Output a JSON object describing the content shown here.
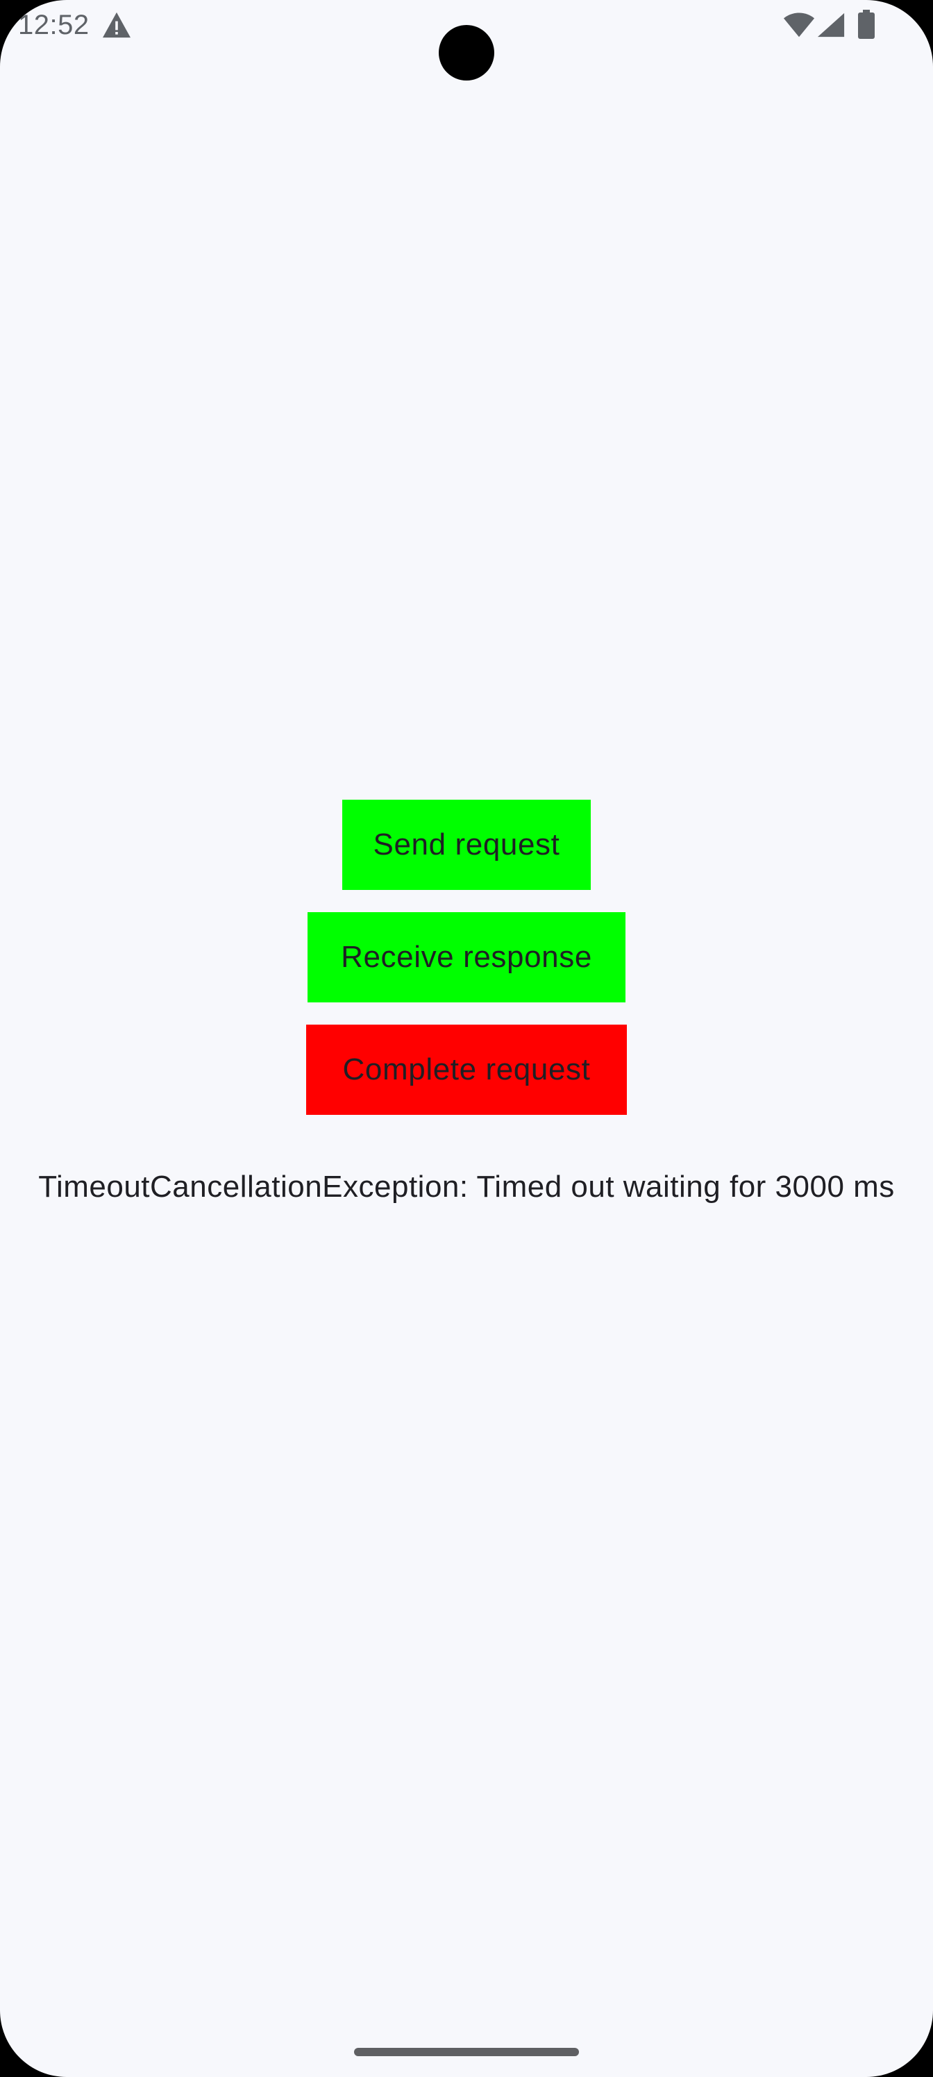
{
  "status_bar": {
    "time": "12:52",
    "icons": [
      "warning-icon",
      "wifi-icon",
      "signal-icon",
      "battery-icon"
    ],
    "icon_color": "#5f6368"
  },
  "buttons": {
    "send_request": {
      "label": "Send request",
      "color": "#00ff00"
    },
    "receive_response": {
      "label": "Receive response",
      "color": "#00ff00"
    },
    "complete_request": {
      "label": "Complete request",
      "color": "#ff0000"
    }
  },
  "status_message": "TimeoutCancellationException: Timed out waiting for 3000 ms",
  "colors": {
    "background": "#f7f8fc",
    "text": "#1f1f24"
  }
}
